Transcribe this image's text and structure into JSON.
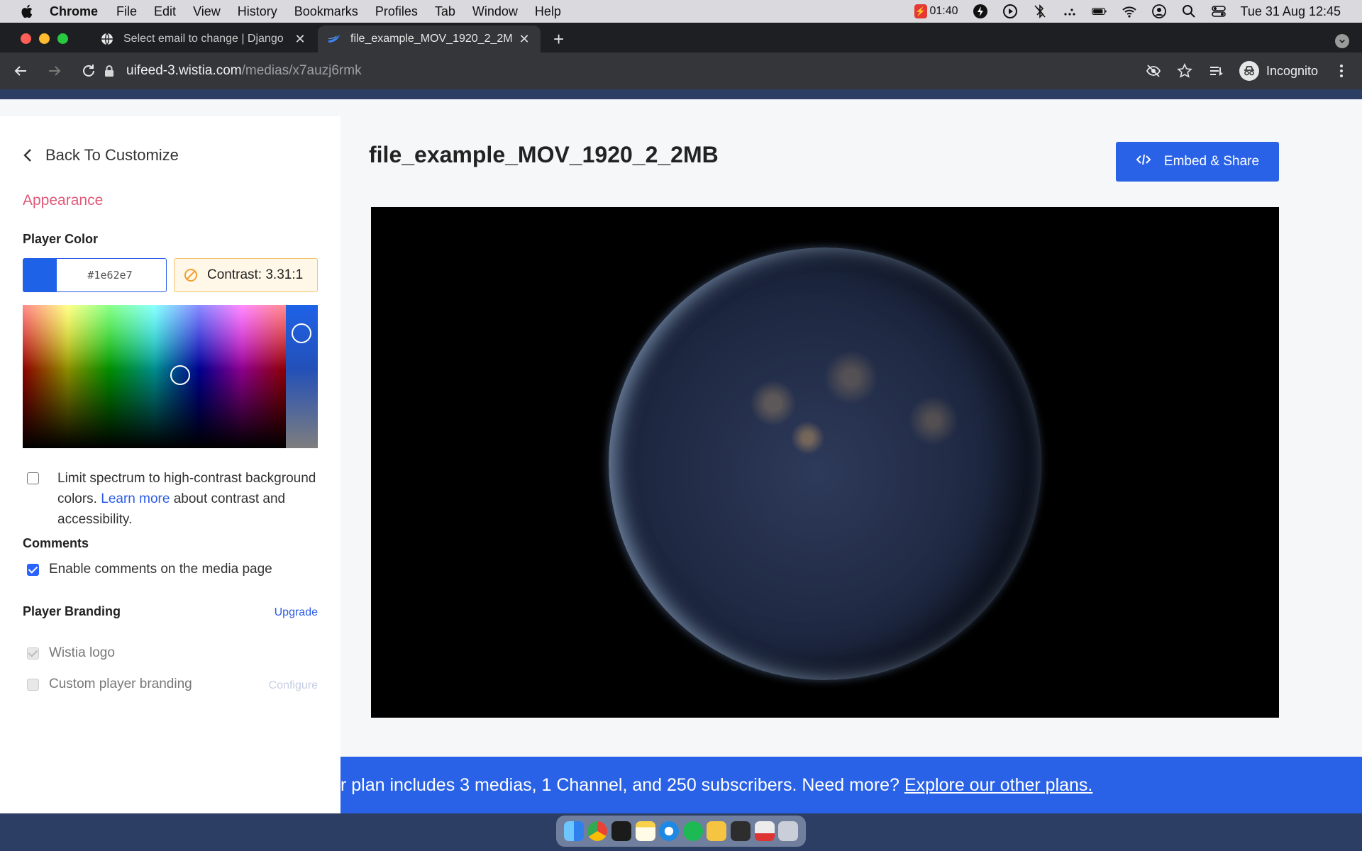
{
  "menubar": {
    "app_name": "Chrome",
    "items": [
      "File",
      "Edit",
      "View",
      "History",
      "Bookmarks",
      "Profiles",
      "Tab",
      "Window",
      "Help"
    ],
    "status_time_badge": "01:40",
    "clock": "Tue 31 Aug  12:45"
  },
  "tabs": [
    {
      "title": "Select email to change | Django",
      "active": false
    },
    {
      "title": "file_example_MOV_1920_2_2M",
      "active": true
    }
  ],
  "toolbar": {
    "url_host": "uifeed-3.wistia.com",
    "url_path": "/medias/x7auzj6rmk",
    "incognito_label": "Incognito"
  },
  "sidebar": {
    "back_label": "Back To Customize",
    "appearance_label": "Appearance",
    "player_color_label": "Player Color",
    "color_value": "#1e62e7",
    "contrast_label": "Contrast: 3.31:1",
    "limit_text_1": "Limit spectrum to high-contrast background colors.",
    "limit_link": "Learn more",
    "limit_text_2": "about contrast and accessibility.",
    "comments_label": "Comments",
    "enable_comments_label": "Enable comments on the media page",
    "branding_label": "Player Branding",
    "upgrade_label": "Upgrade",
    "wistia_logo_label": "Wistia logo",
    "custom_branding_label": "Custom player branding",
    "configure_label": "Configure"
  },
  "main": {
    "title": "file_example_MOV_1920_2_2MB",
    "embed_label": "Embed & Share"
  },
  "banner": {
    "text": "r plan includes 3 medias, 1 Channel, and 250 subscribers. Need more?",
    "link": "Explore our other plans."
  },
  "colors": {
    "accent": "#2962e6",
    "player_color": "#1e62e7",
    "appearance_pink": "#e05a7a",
    "contrast_warning": "#f0a030"
  }
}
